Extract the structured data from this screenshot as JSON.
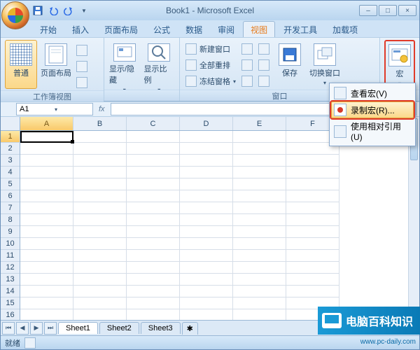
{
  "title": "Book1 - Microsoft Excel",
  "tabs": [
    "开始",
    "插入",
    "页面布局",
    "公式",
    "数据",
    "审阅",
    "视图",
    "开发工具",
    "加载项"
  ],
  "active_tab_index": 6,
  "ribbon": {
    "group1_label": "工作簿视图",
    "btn_normal": "普通",
    "btn_pagelayout": "页面布局",
    "btn_showhide": "显示/隐藏",
    "btn_zoom": "显示比例",
    "group3_label": "窗口",
    "win_new": "新建窗口",
    "win_arrange": "全部重排",
    "win_freeze": "冻结窗格",
    "win_save": "保存",
    "win_switch": "切换窗口",
    "macro_label": "宏"
  },
  "macro_menu": {
    "view": "查看宏(V)",
    "record": "录制宏(R)...",
    "relative": "使用相对引用(U)"
  },
  "namebox": "A1",
  "columns": [
    "A",
    "B",
    "C",
    "D",
    "E",
    "F"
  ],
  "rows": [
    "1",
    "2",
    "3",
    "4",
    "5",
    "6",
    "7",
    "8",
    "9",
    "10",
    "11",
    "12",
    "13",
    "14",
    "15",
    "16"
  ],
  "sheets": [
    "Sheet1",
    "Sheet2",
    "Sheet3"
  ],
  "status": "就绪",
  "watermark": "电脑百科知识",
  "watermark_url": "www.pc-daily.com"
}
